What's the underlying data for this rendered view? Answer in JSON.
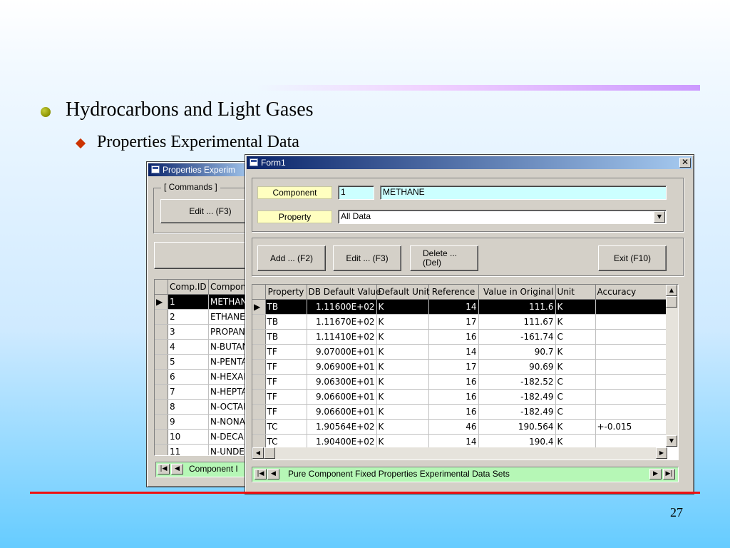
{
  "slide": {
    "bullet1": "Hydrocarbons and Light Gases",
    "bullet2": "Properties Experimental Data",
    "page_number": "27"
  },
  "back_window": {
    "title": "Properties Experim",
    "commands_label": "[ Commands ]",
    "edit_button": "Edit ... (F3)",
    "columns": [
      "Comp.ID",
      "Compone"
    ],
    "rows": [
      {
        "id": "1",
        "name": "METHAN"
      },
      {
        "id": "2",
        "name": "ETHANE"
      },
      {
        "id": "3",
        "name": "PROPAN"
      },
      {
        "id": "4",
        "name": "N-BUTAN"
      },
      {
        "id": "5",
        "name": "N-PENTA"
      },
      {
        "id": "6",
        "name": "N-HEXAN"
      },
      {
        "id": "7",
        "name": "N-HEPTA"
      },
      {
        "id": "8",
        "name": "N-OCTAN"
      },
      {
        "id": "9",
        "name": "N-NONA"
      },
      {
        "id": "10",
        "name": "N-DECAN"
      },
      {
        "id": "11",
        "name": "N-UNDE"
      }
    ],
    "nav_label": "Component I"
  },
  "form1": {
    "title": "Form1",
    "component_label": "Component",
    "component_id": "1",
    "component_name": "METHANE",
    "property_label": "Property",
    "property_value": "All Data",
    "buttons": {
      "add": "Add ... (F2)",
      "edit": "Edit ... (F3)",
      "delete_line1": "Delete ...",
      "delete_line2": "(Del)",
      "exit": "Exit (F10)"
    },
    "columns": [
      "Property",
      "DB Default Value",
      "Default Unit",
      "Reference",
      "Value in Original",
      "Unit",
      "Accuracy"
    ],
    "rows": [
      {
        "property": "TB",
        "db_value": "1.11600E+02",
        "default_unit": "K",
        "reference": "14",
        "original": "111.6",
        "unit": "K",
        "accuracy": ""
      },
      {
        "property": "TB",
        "db_value": "1.11670E+02",
        "default_unit": "K",
        "reference": "17",
        "original": "111.67",
        "unit": "K",
        "accuracy": ""
      },
      {
        "property": "TB",
        "db_value": "1.11410E+02",
        "default_unit": "K",
        "reference": "16",
        "original": "-161.74",
        "unit": "C",
        "accuracy": ""
      },
      {
        "property": "TF",
        "db_value": "9.07000E+01",
        "default_unit": "K",
        "reference": "14",
        "original": "90.7",
        "unit": "K",
        "accuracy": ""
      },
      {
        "property": "TF",
        "db_value": "9.06900E+01",
        "default_unit": "K",
        "reference": "17",
        "original": "90.69",
        "unit": "K",
        "accuracy": ""
      },
      {
        "property": "TF",
        "db_value": "9.06300E+01",
        "default_unit": "K",
        "reference": "16",
        "original": "-182.52",
        "unit": "C",
        "accuracy": ""
      },
      {
        "property": "TF",
        "db_value": "9.06600E+01",
        "default_unit": "K",
        "reference": "16",
        "original": "-182.49",
        "unit": "C",
        "accuracy": ""
      },
      {
        "property": "TF",
        "db_value": "9.06600E+01",
        "default_unit": "K",
        "reference": "16",
        "original": "-182.49",
        "unit": "C",
        "accuracy": ""
      },
      {
        "property": "TC",
        "db_value": "1.90564E+02",
        "default_unit": "K",
        "reference": "46",
        "original": "190.564",
        "unit": "K",
        "accuracy": "+-0.015"
      },
      {
        "property": "TC",
        "db_value": "1.90400E+02",
        "default_unit": "K",
        "reference": "14",
        "original": "190.4",
        "unit": "K",
        "accuracy": ""
      }
    ],
    "nav_label": "Pure Component Fixed Properties Experimental Data Sets"
  },
  "colors": {
    "title_active": "#0a246a",
    "selected_row": "#000000",
    "nav_green": "#b6f7b6",
    "field_cyan": "#ccffff",
    "label_yellow": "#ffffc0",
    "red_line": "#ee1111"
  },
  "icons": [
    "app-icon",
    "close-icon",
    "dropdown-arrow-icon",
    "first-record-icon",
    "prev-record-icon",
    "next-record-icon",
    "last-record-icon",
    "row-pointer-icon",
    "scroll-up-icon",
    "scroll-down-icon",
    "scroll-left-icon",
    "scroll-right-icon"
  ]
}
